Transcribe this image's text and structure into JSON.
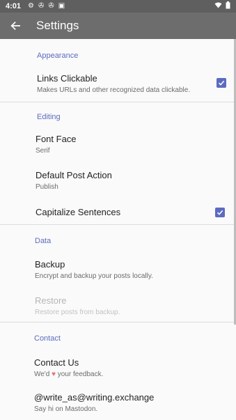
{
  "status_bar": {
    "time": "4:01"
  },
  "app_bar": {
    "title": "Settings"
  },
  "sections": {
    "appearance": {
      "title": "Appearance",
      "links_clickable": {
        "title": "Links Clickable",
        "summary": "Makes URLs and other recognized data clickable.",
        "checked": true
      }
    },
    "editing": {
      "title": "Editing",
      "font_face": {
        "title": "Font Face",
        "summary": "Serif"
      },
      "default_post_action": {
        "title": "Default Post Action",
        "summary": "Publish"
      },
      "capitalize_sentences": {
        "title": "Capitalize Sentences",
        "checked": true
      }
    },
    "data": {
      "title": "Data",
      "backup": {
        "title": "Backup",
        "summary": "Encrypt and backup your posts locally."
      },
      "restore": {
        "title": "Restore",
        "summary": "Restore posts from backup.",
        "enabled": false
      }
    },
    "contact": {
      "title": "Contact",
      "contact_us": {
        "title": "Contact Us",
        "summary_before": "We'd",
        "summary_after": "your feedback."
      },
      "mastodon": {
        "title": "@write_as@writing.exchange",
        "summary": "Say hi on Mastodon."
      }
    }
  },
  "colors": {
    "accent": "#5c6bc0",
    "app_bar": "#6d6d6d",
    "status_bar": "#5f5f5f",
    "heart": "#e57373"
  },
  "icons": {
    "back": "arrow-left-icon",
    "heart": "heart-icon",
    "checkbox": "checkbox-checked-icon"
  }
}
